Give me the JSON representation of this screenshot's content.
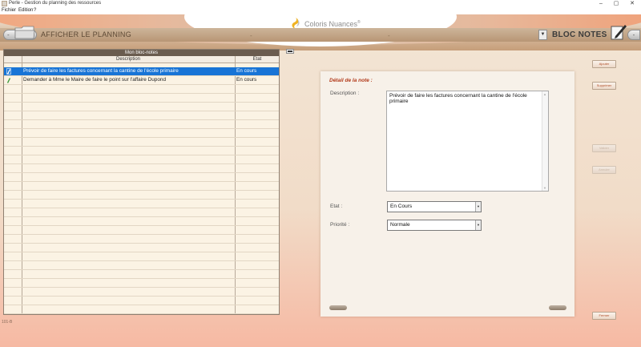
{
  "window": {
    "title": "Perle - Gestion du planning des ressources",
    "controls": [
      "–",
      "▢",
      "✕"
    ]
  },
  "menu": {
    "items": [
      "Fichier",
      "Edition",
      "?"
    ]
  },
  "header": {
    "logo_text": "Coloris Nuances",
    "logo_mark": "®",
    "left_title": "AFFICHER LE PLANNING",
    "left_minus": "-",
    "left_end_sep": "-",
    "right_mid_sep": "-",
    "right_title": "BLOC NOTES",
    "right_dropdown": "▼",
    "right_minus": "-"
  },
  "grid": {
    "title": "Mon bloc-notes",
    "columns": [
      "Description",
      "Etat"
    ],
    "rows": [
      {
        "description": "Prévoir de faire les factures concernant la cantine de l'école primaire",
        "state": "En cours",
        "selected": true
      },
      {
        "description": "Demander à Mme le Maire de faire le point sur l'affaire Dupond",
        "state": "En cours",
        "selected": false
      }
    ],
    "collapse_button": "▬"
  },
  "detail": {
    "title": "Détail de la note :",
    "description_label": "Description :",
    "description_value": "Prévoir de faire les factures concernant la cantine de l'école primaire",
    "state_label": "Etat :",
    "state_value": "En Cours",
    "priority_label": "Priorité :",
    "priority_value": "Normale"
  },
  "actions": {
    "add": "Ajouter",
    "delete": "Supprimer",
    "validate": "Valider",
    "cancel": "Annuler",
    "close": "Fermer"
  },
  "status": {
    "version": "101-B"
  },
  "colors": {
    "selection": "#1874d6",
    "grid_title": "#6a5c4f",
    "accent": "#b23a1a",
    "button_text": "#b04d28"
  }
}
